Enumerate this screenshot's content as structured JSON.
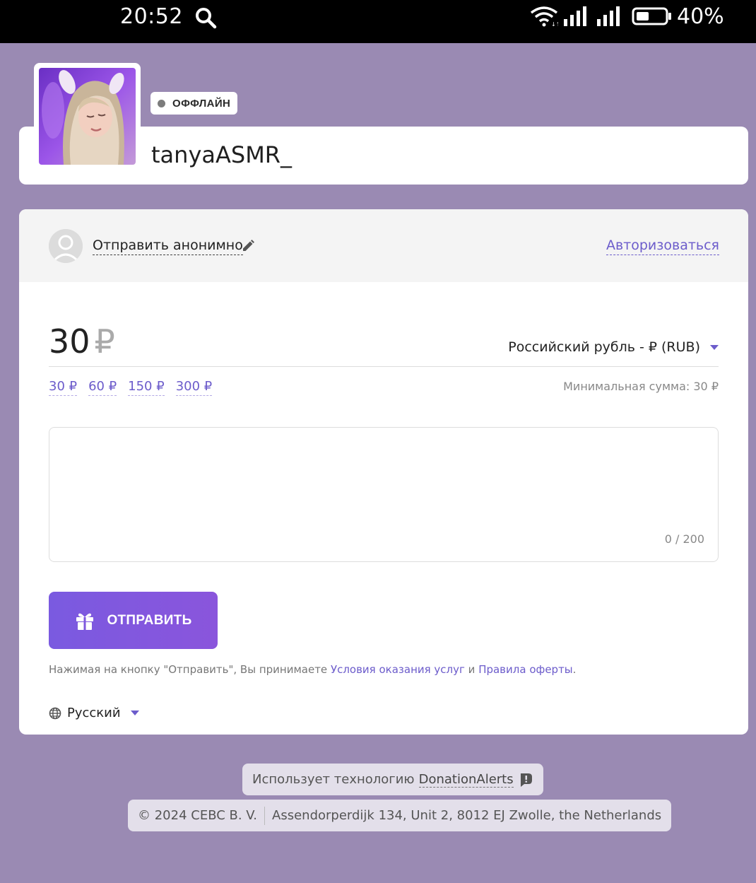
{
  "status_bar": {
    "time": "20:52",
    "battery_percent": "40%",
    "icons": [
      "search-icon",
      "wifi-icon",
      "signal-icon",
      "signal-icon",
      "battery-icon"
    ]
  },
  "profile": {
    "status": "ОФФЛАЙН",
    "username": "tanyaASMR_"
  },
  "donation": {
    "anonymous_label": "Отправить анонимно",
    "login_label": "Авторизоваться",
    "amount": "30",
    "currency_symbol": "₽",
    "currency_select": "Российский рубль - ₽ (RUB)",
    "presets": [
      "30 ₽",
      "60 ₽",
      "150 ₽",
      "300 ₽"
    ],
    "min_sum": "Минимальная сумма: 30 ₽",
    "message_value": "",
    "char_counter": "0 / 200",
    "send_label": "ОТПРАВИТЬ",
    "terms_prefix": "Нажимая на кнопку \"Отправить\", Вы принимаете ",
    "terms_link": "Условия оказания услуг",
    "terms_and": " и ",
    "offer_link": "Правила оферты",
    "terms_suffix": ".",
    "language": "Русский"
  },
  "footer": {
    "powered_prefix": "Использует технологию ",
    "powered_brand": "DonationAlerts",
    "copyright": "© 2024 CEBC B. V.",
    "address": "Assendorperdijk 134, Unit 2, 8012 EJ Zwolle, the Netherlands"
  },
  "colors": {
    "page_background": "#9a8ab3",
    "accent": "#6c5ccb",
    "button": "#7a5ae0"
  }
}
